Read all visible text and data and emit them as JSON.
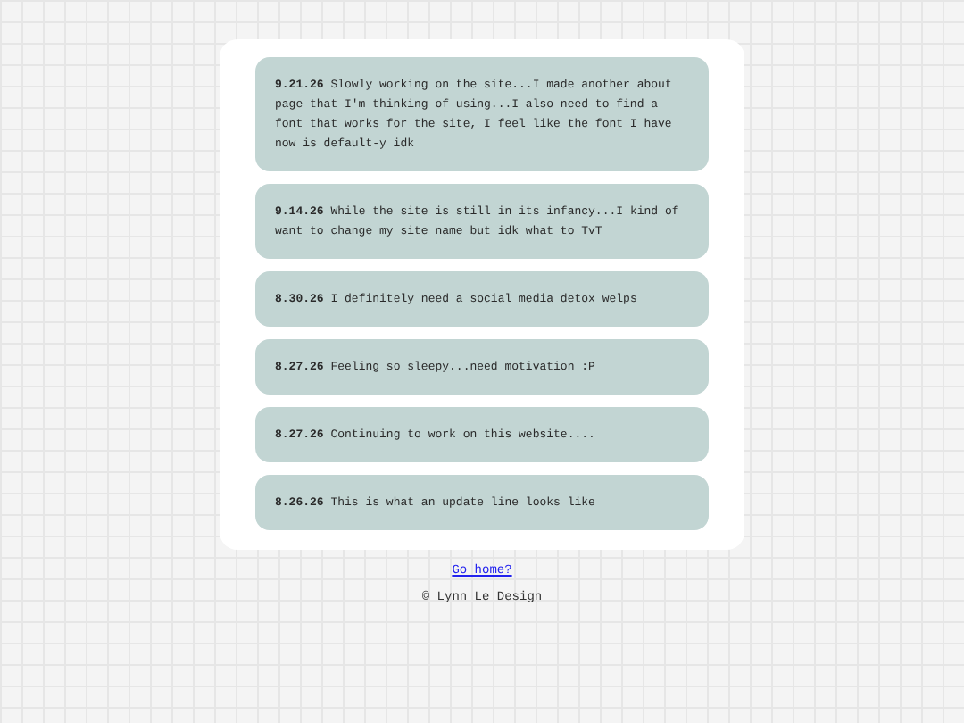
{
  "updates": [
    {
      "text": "**9.21.26** Slowly working on the site...I made another about page that I'm thinking of using...I also need to find a font that works for the site, I feel like the font I have now is default-y idk"
    },
    {
      "text": "**9.14.26** While the site is still in its infancy...I kind of want to change my site name but idk what to TvT"
    },
    {
      "text": "**8.30.26** I definitely need a social media detox welps"
    },
    {
      "text": "**8.27.26** Feeling so sleepy...need motivation :P"
    },
    {
      "text": "**8.27.26** Continuing to work on this website...."
    },
    {
      "text": "**8.26.26** This is what an update line looks like"
    }
  ],
  "footer": {
    "link": "Go home?",
    "copyright": "© Lynn Le Design"
  }
}
